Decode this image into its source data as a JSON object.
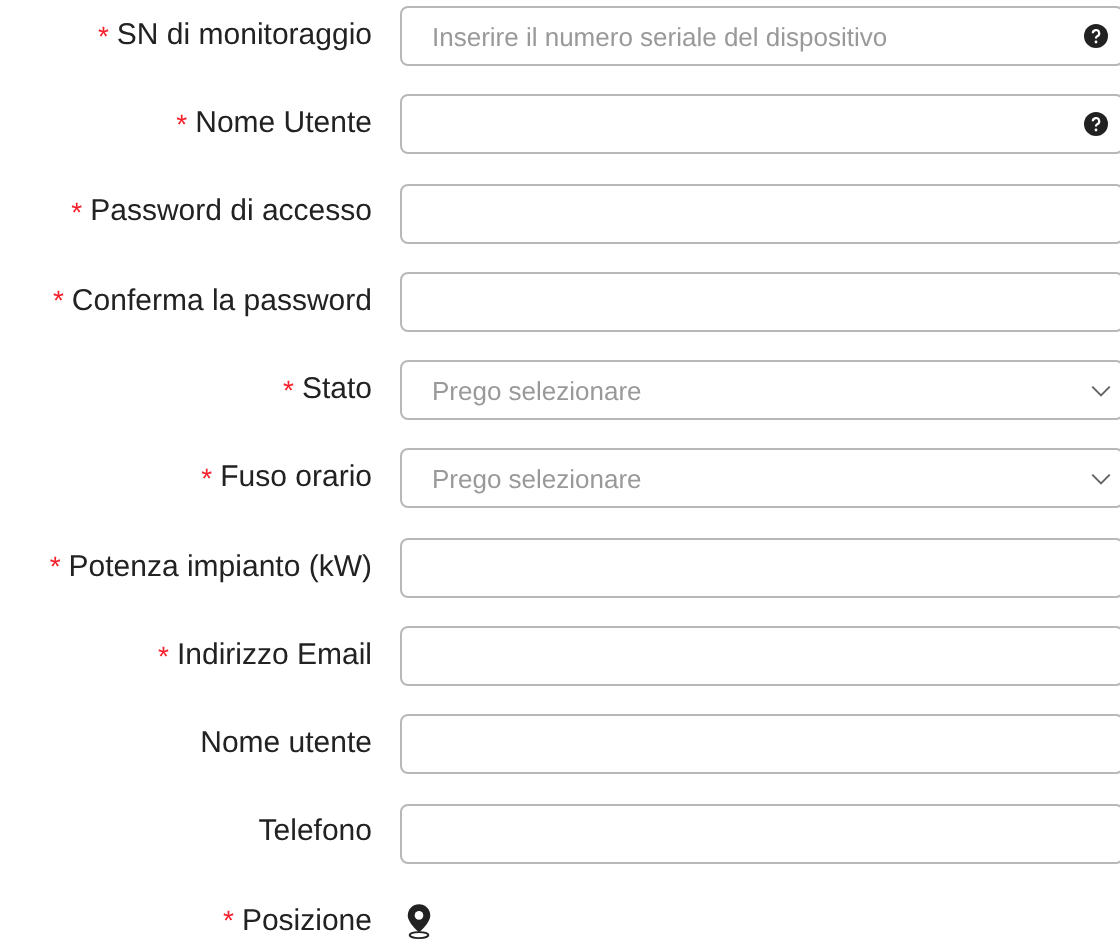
{
  "fields": [
    {
      "label": "SN di monitoraggio",
      "required_marker": "*",
      "kind": "input",
      "placeholder": "Inserire il numero seriale del dispositivo",
      "help": true
    },
    {
      "label": "Nome Utente",
      "required_marker": "*",
      "kind": "input",
      "help": true
    },
    {
      "label": "Password di accesso",
      "required_marker": "*",
      "kind": "input"
    },
    {
      "label": "Conferma la password",
      "required_marker": "*",
      "kind": "input"
    },
    {
      "label": "Stato",
      "required_marker": "*",
      "kind": "select",
      "placeholder": "Prego selezionare"
    },
    {
      "label": "Fuso orario",
      "required_marker": "*",
      "kind": "select",
      "placeholder": "Prego selezionare"
    },
    {
      "label": "Potenza impianto (kW)",
      "required_marker": "*",
      "kind": "input"
    },
    {
      "label": "Indirizzo Email",
      "required_marker": "*",
      "kind": "input"
    },
    {
      "label": "Nome utente",
      "kind": "input"
    },
    {
      "label": "Telefono",
      "kind": "input"
    },
    {
      "label": "Posizione",
      "required_marker": "*",
      "kind": "location"
    }
  ]
}
